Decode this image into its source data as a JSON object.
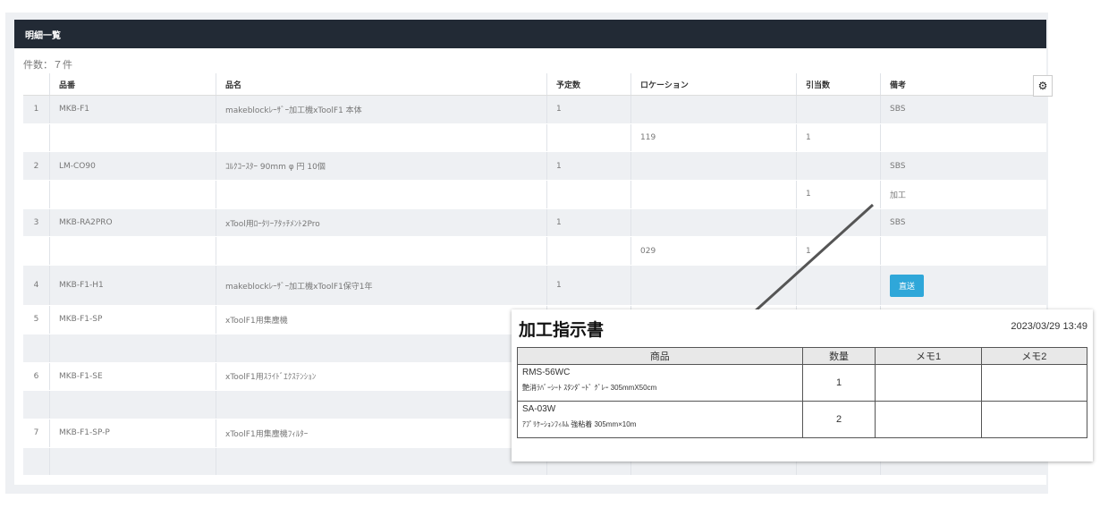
{
  "header": {
    "title": "明細一覧"
  },
  "count": {
    "label": "件数：７件"
  },
  "table": {
    "columns": [
      "",
      "品番",
      "品名",
      "予定数",
      "ロケーション",
      "引当数",
      "備考"
    ],
    "rows": [
      [
        "1",
        "MKB-F1",
        "makeblockﾚｰｻﾞｰ加工機xToolF1 本体",
        "1",
        "",
        "",
        "SBS"
      ],
      [
        "",
        "",
        "",
        "",
        "119",
        "1",
        ""
      ],
      [
        "2",
        "LM-CO90",
        "ｺﾙｸｺｰｽﾀｰ 90mm φ 円 10個",
        "1",
        "",
        "",
        "SBS"
      ],
      [
        "",
        "",
        "",
        "",
        "",
        "1",
        "加工"
      ],
      [
        "3",
        "MKB-RA2PRO",
        "xTool用ﾛｰﾀﾘｰｱﾀｯﾁﾒﾝﾄ2Pro",
        "1",
        "",
        "",
        "SBS"
      ],
      [
        "",
        "",
        "",
        "",
        "029",
        "1",
        ""
      ],
      [
        "4",
        "MKB-F1-H1",
        "makeblockﾚｰｻﾞｰ加工機xToolF1保守1年",
        "1",
        "",
        "",
        ""
      ],
      [
        "5",
        "MKB-F1-SP",
        "xToolF1用集塵機",
        "",
        "",
        "",
        ""
      ],
      [
        "",
        "",
        "",
        "",
        "",
        "",
        ""
      ],
      [
        "6",
        "MKB-F1-SE",
        "xToolF1用ｽﾗｲﾄﾞｴｸｽﾃﾝｼｮﾝ",
        "",
        "",
        "",
        ""
      ],
      [
        "",
        "",
        "",
        "",
        "",
        "",
        ""
      ],
      [
        "7",
        "MKB-F1-SP-P",
        "xToolF1用集塵機ﾌｨﾙﾀｰ",
        "",
        "",
        "",
        ""
      ],
      [
        "",
        "",
        "",
        "",
        "",
        "",
        ""
      ]
    ],
    "direct_button": "直送"
  },
  "slip": {
    "title": "加工指示書",
    "date": "2023/03/29 13:49",
    "columns": [
      "商品",
      "数量",
      "メモ1",
      "メモ2"
    ],
    "items": [
      {
        "code": "RMS-56WC",
        "name": "艶消ﾗﾊﾞｰｼｰﾄ ｽﾀﾝﾀﾞｰﾄﾞ ｸﾞﾚｰ 305mmX50cm",
        "qty": "1"
      },
      {
        "code": "SA-03W",
        "name": "ｱﾌﾟﾘｹｰｼｮﾝﾌｨﾙﾑ 強粘着 305mm×10m",
        "qty": "2"
      }
    ]
  },
  "icons": {
    "settings": "gear-icon"
  }
}
